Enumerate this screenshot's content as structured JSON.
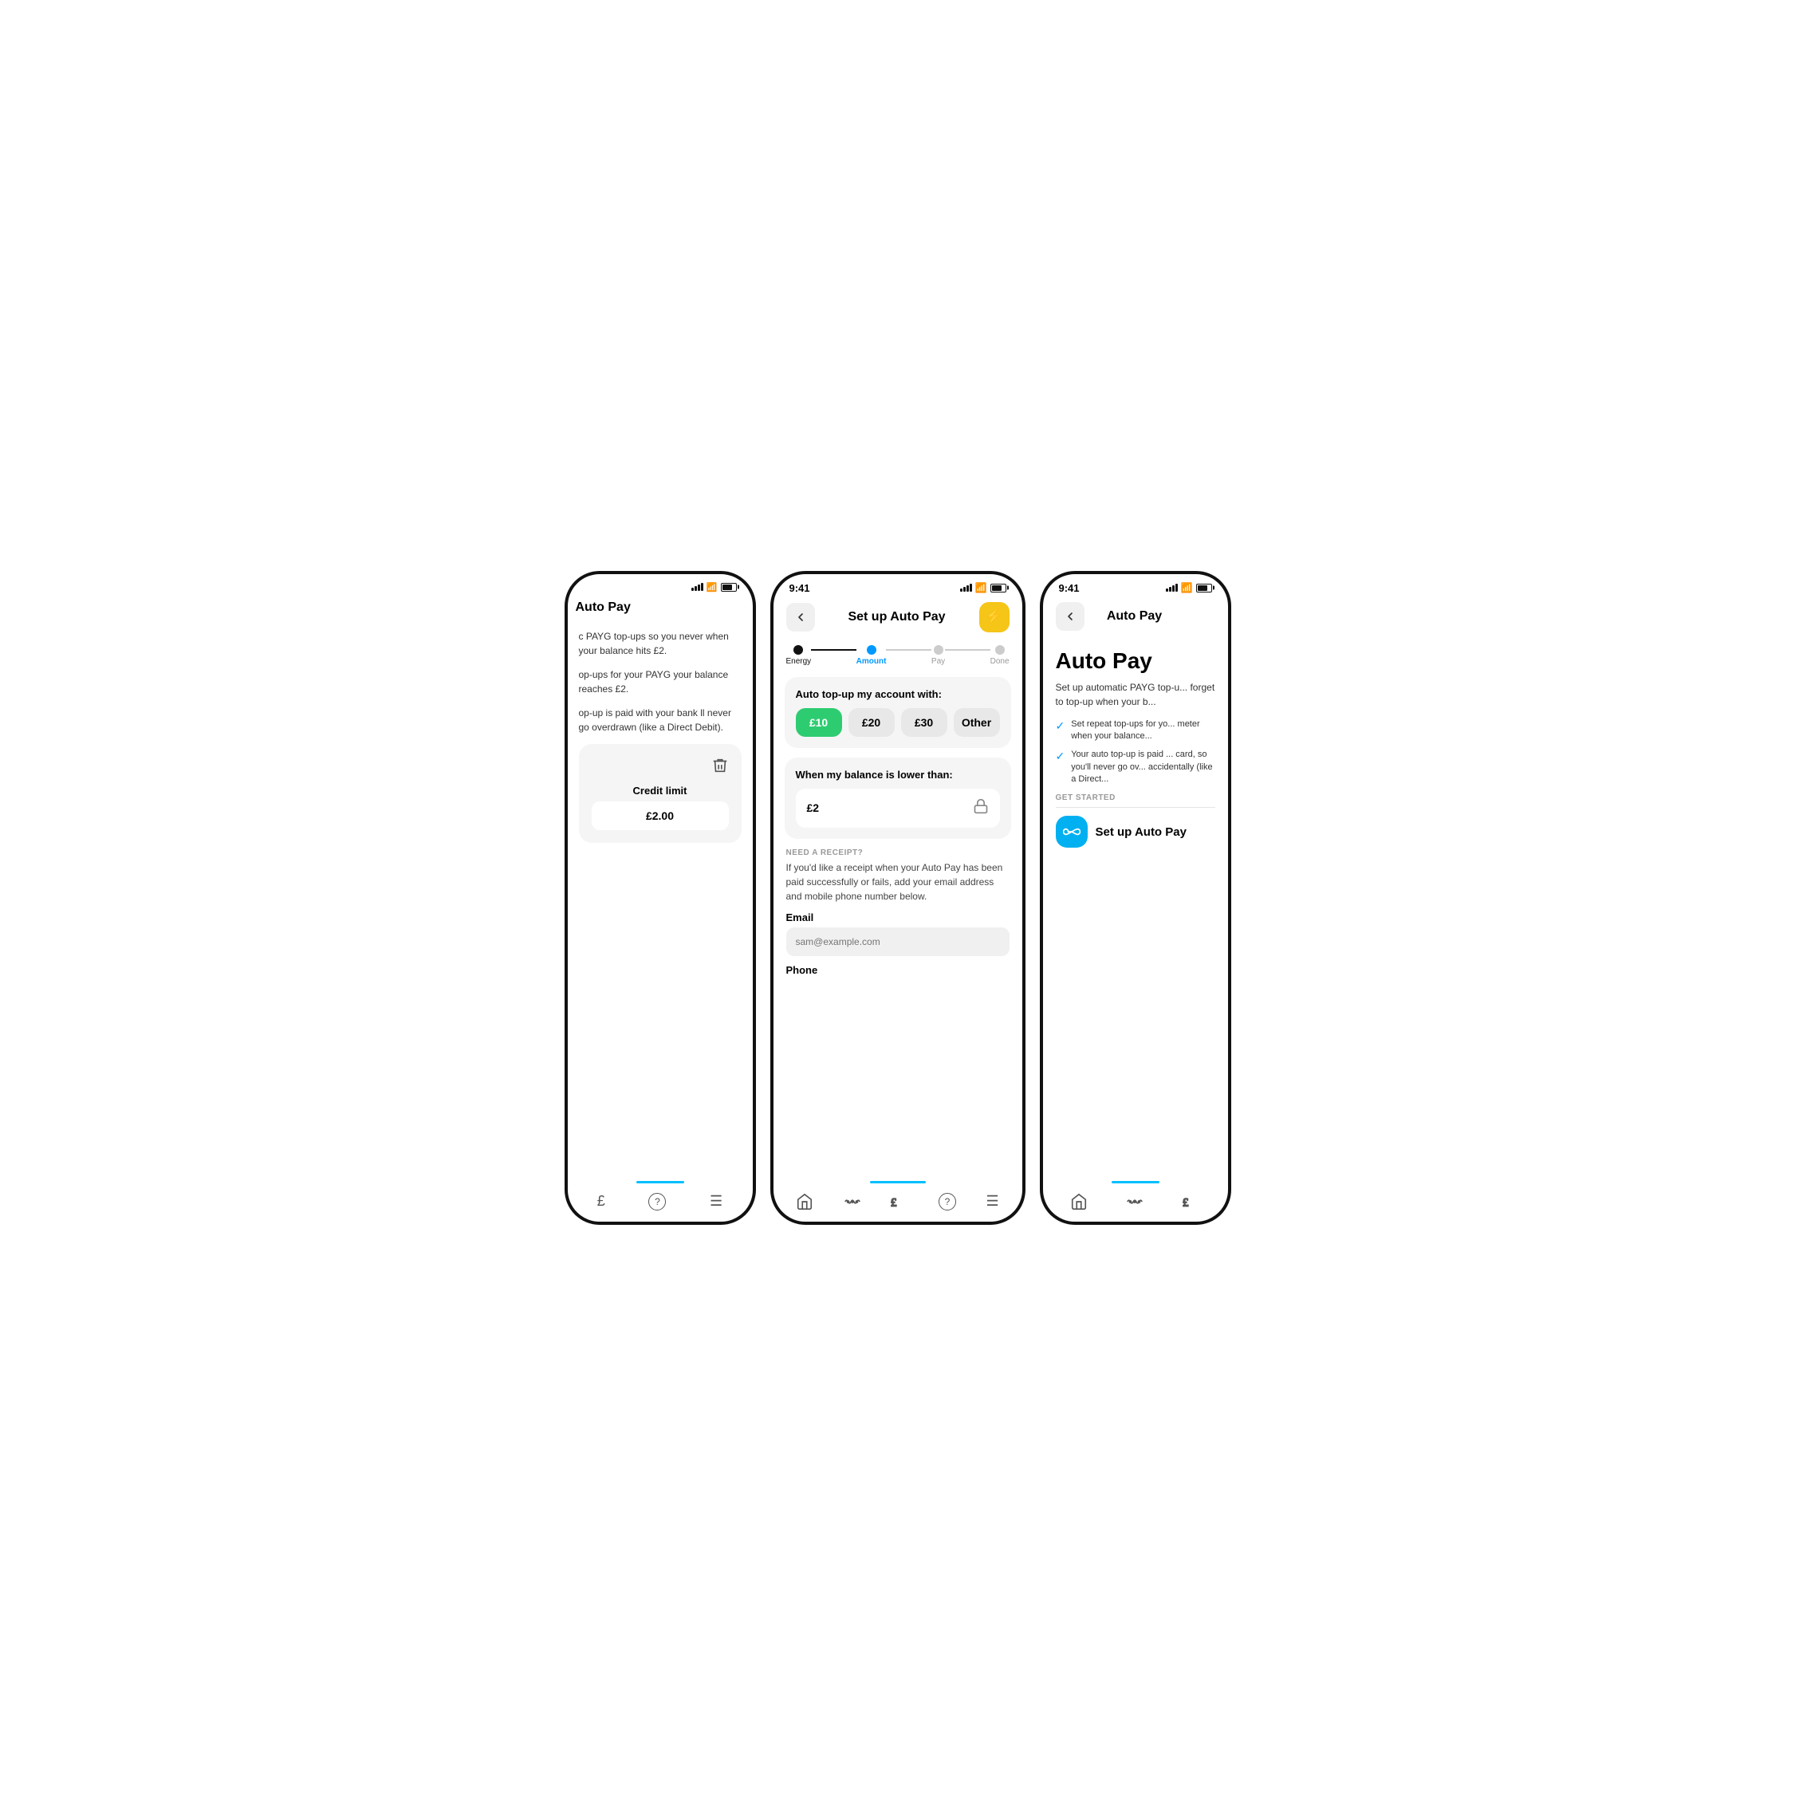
{
  "phones": {
    "left": {
      "title": "Auto Pay",
      "description1": "c PAYG top-ups so you never when your balance hits £2.",
      "description2": "op-ups for your PAYG your balance reaches £2.",
      "description3": "op-up is paid with your bank ll never go overdrawn (like a Direct Debit).",
      "credit_limit_label": "Credit limit",
      "credit_limit_value": "£2.00",
      "bottom_nav": [
        "£",
        "?",
        "≡"
      ]
    },
    "center": {
      "status_time": "9:41",
      "nav_title": "Set up Auto Pay",
      "nav_back": "←",
      "nav_action_icon": "⚡",
      "stepper": [
        {
          "label": "Energy",
          "state": "done"
        },
        {
          "label": "Amount",
          "state": "active"
        },
        {
          "label": "Pay",
          "state": "upcoming"
        },
        {
          "label": "Done",
          "state": "upcoming"
        }
      ],
      "top_up_card": {
        "title": "Auto top-up my account with:",
        "options": [
          {
            "label": "£10",
            "selected": true
          },
          {
            "label": "£20",
            "selected": false
          },
          {
            "label": "£30",
            "selected": false
          },
          {
            "label": "Other",
            "selected": false
          }
        ]
      },
      "balance_card": {
        "title": "When my balance is lower than:",
        "value": "£2"
      },
      "receipt": {
        "section_label": "NEED A RECEIPT?",
        "description": "If you'd like a receipt when your Auto Pay has been paid successfully or fails, add your email address and mobile phone number below.",
        "email_label": "Email",
        "email_placeholder": "sam@example.com",
        "phone_label": "Phone"
      },
      "bottom_nav": [
        "🏠",
        "∿∿",
        "£",
        "?",
        "≡"
      ]
    },
    "right": {
      "status_time": "9:41",
      "nav_title": "Auto Pay",
      "nav_back": "←",
      "page_title": "Auto Pay",
      "description": "Set up automatic PAYG top-u... forget to top-up when your b...",
      "checks": [
        "Set repeat top-ups for yo... meter when your balance...",
        "Your auto top-up is paid ... card, so you'll never go ov... accidentally (like a Direct..."
      ],
      "get_started_label": "GET STARTED",
      "setup_btn_label": "Set up Auto Pay",
      "bottom_nav": [
        "🏠",
        "∿∿",
        "£"
      ]
    }
  },
  "colors": {
    "active_step": "#0099ff",
    "selected_amount": "#2ecc71",
    "nav_action": "#f5c518",
    "setup_btn": "#00b0f0",
    "indicator": "#00bfff"
  }
}
